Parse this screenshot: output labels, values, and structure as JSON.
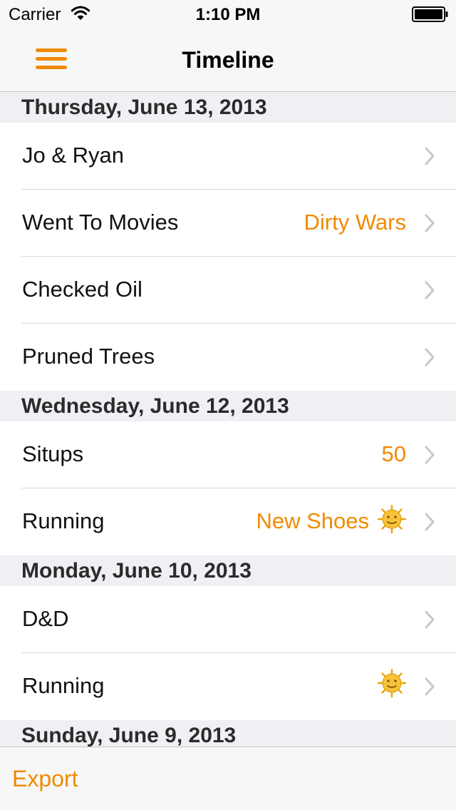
{
  "status_bar": {
    "carrier": "Carrier",
    "time": "1:10 PM"
  },
  "nav": {
    "title": "Timeline",
    "menu_icon": "hamburger-icon"
  },
  "sections": [
    {
      "header": "Thursday, June 13, 2013",
      "rows": [
        {
          "title": "Jo & Ryan",
          "detail": ""
        },
        {
          "title": "Went To Movies",
          "detail": "Dirty Wars"
        },
        {
          "title": "Checked Oil",
          "detail": ""
        },
        {
          "title": "Pruned Trees",
          "detail": ""
        }
      ]
    },
    {
      "header": "Wednesday, June 12, 2013",
      "rows": [
        {
          "title": "Situps",
          "detail": "50"
        },
        {
          "title": "Running",
          "detail": "New Shoes",
          "icon": "sun-face-icon"
        }
      ]
    },
    {
      "header": "Monday, June 10, 2013",
      "rows": [
        {
          "title": "D&D",
          "detail": ""
        },
        {
          "title": "Running",
          "detail": "",
          "icon": "sun-face-icon"
        }
      ]
    },
    {
      "header": "Sunday, June 9, 2013",
      "rows": []
    }
  ],
  "toolbar": {
    "export_label": "Export"
  },
  "colors": {
    "accent": "#f08a00",
    "section_bg": "#efeff4",
    "bar_bg": "#f7f7f7"
  }
}
